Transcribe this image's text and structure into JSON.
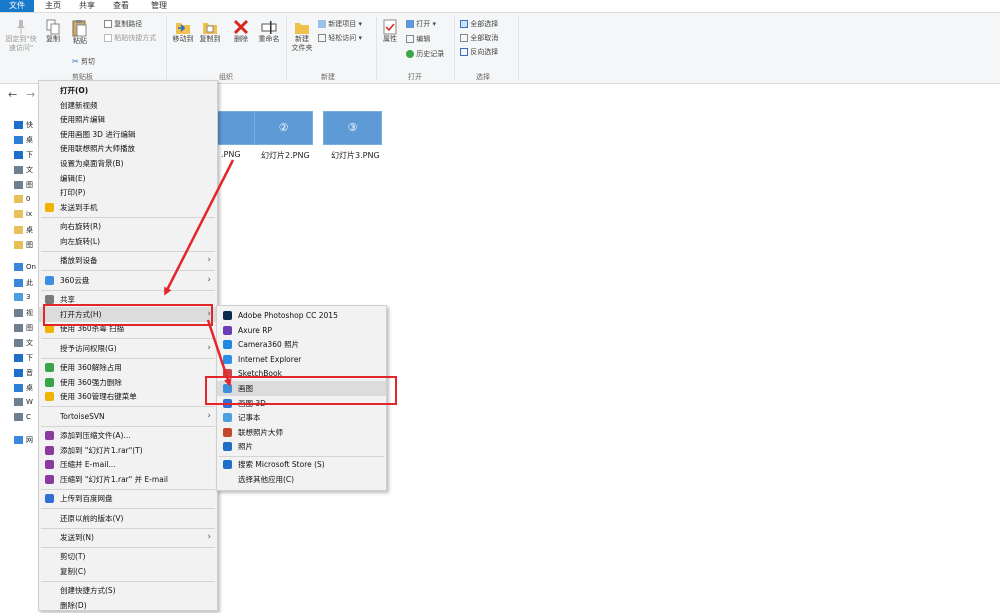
{
  "tabs": [
    "文件",
    "主页",
    "共享",
    "查看",
    "管理"
  ],
  "ribbon": {
    "clipboard": {
      "title": "剪贴板",
      "pin_quick": "固定到\"快\n速访问\"",
      "copy": "复制",
      "paste": "粘贴",
      "copy_path": "复制路径",
      "paste_shortcut": "粘贴快捷方式",
      "cut": "剪切"
    },
    "organize": {
      "title": "组织",
      "move_to": "移动到",
      "copy_to": "复制到",
      "delete": "删除",
      "rename": "重命名"
    },
    "new": {
      "title": "新建",
      "new_folder": "新建\n文件夹",
      "new_item": "新建项目",
      "easy_access": "轻松访问"
    },
    "open": {
      "title": "打开",
      "properties": "属性",
      "open": "打开",
      "edit": "编辑",
      "history": "历史记录"
    },
    "select": {
      "title": "选择",
      "select_all": "全部选择",
      "select_none": "全部取消",
      "invert": "反向选择"
    }
  },
  "nav": {
    "back": "←",
    "forward": "→"
  },
  "navpane": [
    {
      "text": "快",
      "color": "#1e6fc7"
    },
    {
      "text": "桌",
      "color": "#2a7fd4"
    },
    {
      "text": "下",
      "color": "#1e6fc7"
    },
    {
      "text": "文",
      "color": "#6d7f91"
    },
    {
      "text": "图",
      "color": "#6d7f91"
    },
    {
      "text": "0",
      "color": "#e8c05a"
    },
    {
      "text": "ix",
      "color": "#e8c05a"
    },
    {
      "text": "桌",
      "color": "#e8c05a"
    },
    {
      "text": "图",
      "color": "#e8c05a"
    },
    {
      "text": "On",
      "color": "#3b87d9"
    },
    {
      "text": "此",
      "color": "#3b87d9"
    },
    {
      "text": "3",
      "color": "#4b9fe0"
    },
    {
      "text": "视",
      "color": "#6d7f91"
    },
    {
      "text": "图",
      "color": "#6d7f91"
    },
    {
      "text": "文",
      "color": "#6d7f91"
    },
    {
      "text": "下",
      "color": "#1e6fc7"
    },
    {
      "text": "音",
      "color": "#1e6fc7"
    },
    {
      "text": "桌",
      "color": "#2a7fd4"
    },
    {
      "text": "W",
      "color": "#6d7f91"
    },
    {
      "text": "C",
      "color": "#6d7f91"
    },
    {
      "text": "网",
      "color": "#3b87d9"
    }
  ],
  "files": [
    {
      "label": ".PNG",
      "glyph": ""
    },
    {
      "label": "幻灯片2.PNG",
      "glyph": "②"
    },
    {
      "label": "幻灯片3.PNG",
      "glyph": "③"
    }
  ],
  "context_menu": [
    {
      "label": "打开(O)",
      "bold": true
    },
    {
      "label": "创建新视频"
    },
    {
      "label": "使用照片编辑"
    },
    {
      "label": "使用画图 3D 进行编辑"
    },
    {
      "label": "使用联想照片大师播放"
    },
    {
      "label": "设置为桌面背景(B)"
    },
    {
      "label": "编辑(E)"
    },
    {
      "label": "打印(P)"
    },
    {
      "label": "发送到手机",
      "icon_color": "#f0b400"
    },
    {
      "sep": true
    },
    {
      "label": "向右旋转(R)"
    },
    {
      "label": "向左旋转(L)"
    },
    {
      "sep": true
    },
    {
      "label": "播放到设备",
      "submenu": true
    },
    {
      "sep": true
    },
    {
      "label": "360云盘",
      "submenu": true,
      "icon_color": "#3a8fe0"
    },
    {
      "sep": true
    },
    {
      "label": "共享",
      "icon_color": "#7a7a7a"
    },
    {
      "label": "打开方式(H)",
      "submenu": true,
      "highlight": true
    },
    {
      "label": "使用 360杀毒 扫描",
      "icon_color": "#f0b400"
    },
    {
      "sep": true
    },
    {
      "label": "授予访问权限(G)",
      "submenu": true
    },
    {
      "sep": true
    },
    {
      "label": "使用 360解除占用",
      "icon_color": "#3aa548"
    },
    {
      "label": "使用 360强力删除",
      "icon_color": "#3aa548"
    },
    {
      "label": "使用 360管理右键菜单",
      "icon_color": "#f0b400"
    },
    {
      "sep": true
    },
    {
      "label": "TortoiseSVN",
      "submenu": true
    },
    {
      "sep": true
    },
    {
      "label": "添加到压缩文件(A)...",
      "icon_color": "#8b3aa0"
    },
    {
      "label": "添加到 \"幻灯片1.rar\"(T)",
      "icon_color": "#8b3aa0"
    },
    {
      "label": "压缩并 E-mail...",
      "icon_color": "#8b3aa0"
    },
    {
      "label": "压缩到 \"幻灯片1.rar\" 并 E-mail",
      "icon_color": "#8b3aa0"
    },
    {
      "sep": true
    },
    {
      "label": "上传到百度网盘",
      "icon_color": "#2f6fd6"
    },
    {
      "sep": true
    },
    {
      "label": "还原以前的版本(V)"
    },
    {
      "sep": true
    },
    {
      "label": "发送到(N)",
      "submenu": true
    },
    {
      "sep": true
    },
    {
      "label": "剪切(T)"
    },
    {
      "label": "复制(C)"
    },
    {
      "sep": true
    },
    {
      "label": "创建快捷方式(S)"
    },
    {
      "label": "删除(D)"
    }
  ],
  "open_with_menu": [
    {
      "label": "Adobe Photoshop CC 2015",
      "icon_color": "#0b2c4e"
    },
    {
      "label": "Axure RP",
      "icon_color": "#6a3fb8"
    },
    {
      "label": "Camera360 照片",
      "icon_color": "#1f87e0"
    },
    {
      "label": "Internet Explorer",
      "icon_color": "#2b8fe8"
    },
    {
      "label": "SketchBook",
      "icon_color": "#c44"
    },
    {
      "label": "画图",
      "icon_color": "#3c8fd8",
      "highlight": true
    },
    {
      "label": "画图 3D",
      "icon_color": "#2f6fd6"
    },
    {
      "label": "记事本",
      "icon_color": "#4aa0e0"
    },
    {
      "label": "联想照片大师",
      "icon_color": "#c24a2a"
    },
    {
      "label": "照片",
      "icon_color": "#1f6fc8"
    },
    {
      "sep": true
    },
    {
      "label": "搜索 Microsoft Store (S)",
      "icon_color": "#1f6fc8"
    },
    {
      "label": "选择其他应用(C)"
    }
  ],
  "colors": {
    "accent": "#1979ca",
    "annotation_red": "#e3262b",
    "menu_bg": "#f2f2f2"
  }
}
